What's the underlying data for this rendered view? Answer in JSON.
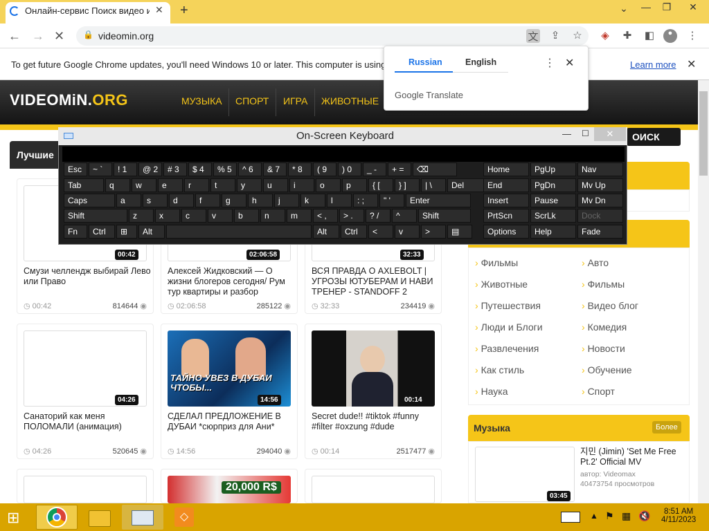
{
  "browser": {
    "tab_title": "Онлайн-сервис Поиск видео и",
    "url": "videomin.org",
    "new_tab": "+",
    "close": "✕"
  },
  "infobar": {
    "text": "To get future Google Chrome updates, you'll need Windows 10 or later. This computer is using",
    "learn_more": "Learn more"
  },
  "translate": {
    "tab_russian": "Russian",
    "tab_english": "English",
    "brand_google": "Google",
    "brand_translate": "Translate"
  },
  "site": {
    "logo_main": "VIDEOMiN.",
    "logo_ext": "ORG",
    "nav": [
      "МУЗЫКА",
      "СПОРТ",
      "ИГРА",
      "ЖИВОТНЫЕ"
    ],
    "search_label": "ОИСК",
    "best_label": "Лучшие"
  },
  "videos": [
    {
      "title": "Смузи челлендж выбирай Лево или Право",
      "duration": "00:42",
      "time": "00:42",
      "views": "814644"
    },
    {
      "title": "Алексей Жидковский — О жизни блогеров сегодня/ Рум тур квартиры и разбор",
      "duration": "02:06:58",
      "time": "02:06:58",
      "views": "285122"
    },
    {
      "title": "ВСЯ ПРАВДА О AXLEBOLT | УГРОЗЫ ЮТУБЕРАМ И НАВИ ТРЕНЕР - STANDOFF 2",
      "duration": "32:33",
      "time": "32:33",
      "views": "234419"
    },
    {
      "title": "Санаторий как меня ПОЛОМАЛИ (анимация)",
      "duration": "04:26",
      "time": "04:26",
      "views": "520645"
    },
    {
      "title": "СДЕЛАЛ ПРЕДЛОЖЕНИЕ В ДУБАИ *сюрприз для Ани*",
      "duration": "14:56",
      "time": "14:56",
      "views": "294040",
      "thumb_text": "ТАЙНО УВЕЗ В ДУБАИ ЧТОБЫ..."
    },
    {
      "title": "Secret dude!! #tiktok #funny #filter #oxzung #dude",
      "duration": "00:14",
      "time": "00:14",
      "views": "2517477"
    }
  ],
  "thumb_row3": {
    "overlay": "20,000 R$"
  },
  "categories": {
    "left": [
      "Фильмы",
      "Животные",
      "Путешествия",
      "Люди и Блоги",
      "Развлечения",
      "Как стиль",
      "Наука"
    ],
    "right": [
      "Авто",
      "Фильмы",
      "Видео блог",
      "Комедия",
      "Новости",
      "Обучение",
      "Спорт"
    ]
  },
  "music": {
    "header": "Музыка",
    "more": "Более",
    "item_title": "지민 (Jimin) 'Set Me Free Pt.2' Official MV",
    "item_author": "автор: Videomax",
    "item_views": "40473754 просмотров",
    "item_duration": "03:45"
  },
  "osk": {
    "title": "On-Screen Keyboard",
    "rows": [
      [
        "Esc",
        "~ `",
        "! 1",
        "@ 2",
        "# 3",
        "$ 4",
        "% 5",
        "^ 6",
        "& 7",
        "* 8",
        "( 9",
        ") 0",
        "_ -",
        "+ =",
        "⌫"
      ],
      [
        "Tab",
        "q",
        "w",
        "e",
        "r",
        "t",
        "y",
        "u",
        "i",
        "o",
        "p",
        "{ [",
        "} ]",
        "| \\",
        "Del"
      ],
      [
        "Caps",
        "a",
        "s",
        "d",
        "f",
        "g",
        "h",
        "j",
        "k",
        "l",
        ": ;",
        "\" '",
        "Enter"
      ],
      [
        "Shift",
        "z",
        "x",
        "c",
        "v",
        "b",
        "n",
        "m",
        "< ,",
        "> .",
        "? /",
        "^",
        "Shift"
      ],
      [
        "Fn",
        "Ctrl",
        "⊞",
        "Alt",
        "",
        "Alt",
        "Ctrl",
        "<",
        "v",
        ">",
        "▤"
      ]
    ],
    "nav_keys": [
      [
        "Home",
        "PgUp",
        "Nav"
      ],
      [
        "End",
        "PgDn",
        "Mv Up"
      ],
      [
        "Insert",
        "Pause",
        "Mv Dn"
      ],
      [
        "PrtScn",
        "ScrLk",
        "Dock"
      ],
      [
        "Options",
        "Help",
        "Fade"
      ]
    ]
  },
  "taskbar": {
    "time": "8:51 AM",
    "date": "4/11/2023"
  }
}
